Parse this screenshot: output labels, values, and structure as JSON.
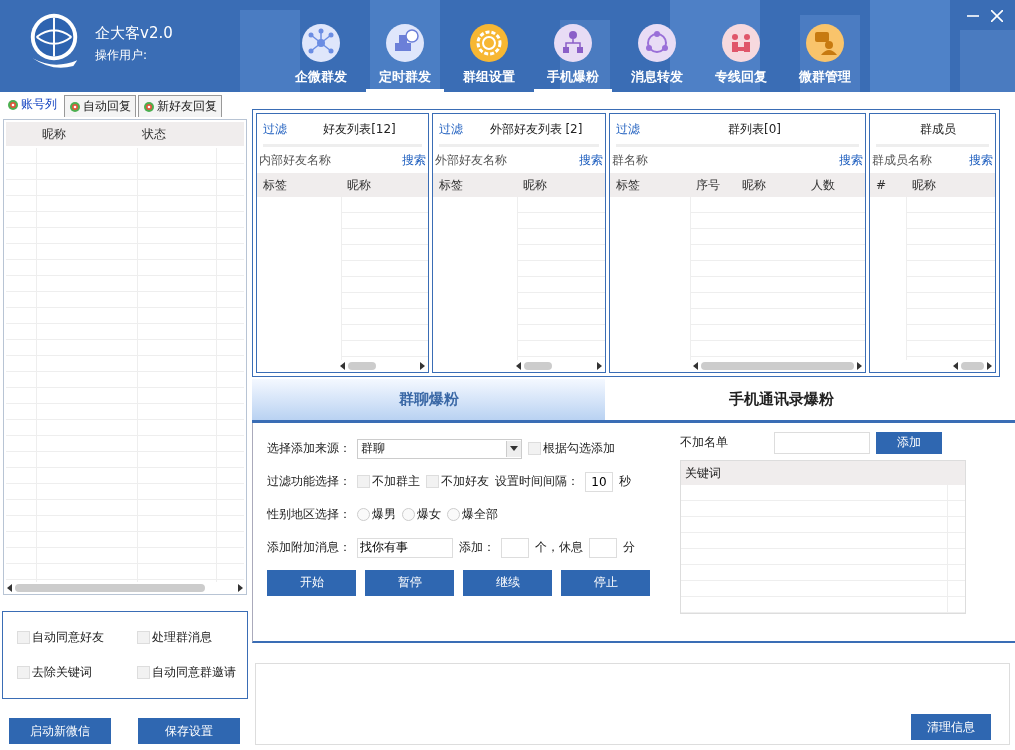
{
  "header": {
    "title": "企大客v2.0",
    "user_label": "操作用户:"
  },
  "nav": [
    {
      "label": "企微群发",
      "selected": false
    },
    {
      "label": "定时群发",
      "selected": true
    },
    {
      "label": "群组设置",
      "selected": false
    },
    {
      "label": "手机爆粉",
      "selected": true
    },
    {
      "label": "消息转发",
      "selected": false
    },
    {
      "label": "专线回复",
      "selected": false
    },
    {
      "label": "微群管理",
      "selected": false
    }
  ],
  "left_tabs": [
    {
      "label": "账号列",
      "selected": true
    },
    {
      "label": "自动回复",
      "selected": false
    },
    {
      "label": "新好友回复",
      "selected": false
    }
  ],
  "accounts_table": {
    "columns": [
      "昵称",
      "状态"
    ]
  },
  "options": [
    {
      "label": "自动同意好友",
      "checked": false
    },
    {
      "label": "处理群消息",
      "checked": false
    },
    {
      "label": "去除关键词",
      "checked": false
    },
    {
      "label": "自动同意群邀请",
      "checked": false
    }
  ],
  "left_buttons": [
    "启动新微信",
    "保存设置"
  ],
  "lists": [
    {
      "filter": "过滤",
      "title": "好友列表[12]",
      "search_label": "内部好友名称",
      "search_button": "搜索",
      "columns": [
        "标签",
        "昵称"
      ]
    },
    {
      "filter": "过滤",
      "title": "外部好友列表 [2]",
      "search_label": "外部好友名称",
      "search_button": "搜索",
      "columns": [
        "标签",
        "昵称"
      ]
    },
    {
      "filter": "过滤",
      "title": "群列表[0]",
      "search_label": "群名称",
      "search_button": "搜索",
      "columns": [
        "标签",
        "序号",
        "昵称",
        "人数"
      ]
    },
    {
      "title": "群成员",
      "search_label": "群成员名称",
      "search_button": "搜索",
      "columns": [
        "#",
        "昵称"
      ]
    }
  ],
  "mode_tabs": [
    {
      "label": "群聊爆粉",
      "selected": true
    },
    {
      "label": "手机通讯录爆粉",
      "selected": false
    }
  ],
  "form": {
    "source_label": "选择添加来源：",
    "source_value": "群聊",
    "by_check": {
      "label": "根据勾选添加",
      "checked": false
    },
    "filter_label": "过滤功能选择：",
    "filters": [
      {
        "label": "不加群主",
        "checked": false
      },
      {
        "label": "不加好友",
        "checked": false
      }
    ],
    "interval_label": "设置时间间隔：",
    "interval_value": "10",
    "interval_unit": "秒",
    "gender_label": "性别地区选择：",
    "genders": [
      {
        "label": "爆男",
        "selected": false
      },
      {
        "label": "爆女",
        "selected": false
      },
      {
        "label": "爆全部",
        "selected": false
      }
    ],
    "message_label": "添加附加消息：",
    "message_value": "找你有事",
    "add_label": "添加：",
    "add_unit": "个，休息",
    "rest_unit": "分",
    "buttons": [
      "开始",
      "暂停",
      "继续",
      "停止"
    ]
  },
  "blacklist": {
    "label": "不加名单",
    "add_button": "添加",
    "column": "关键词"
  },
  "log": {
    "clear_button": "清理信息"
  }
}
